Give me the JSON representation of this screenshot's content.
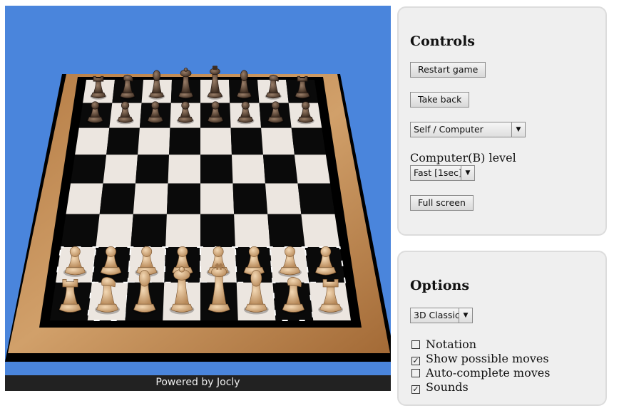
{
  "footer": {
    "text": "Powered by Jocly"
  },
  "board": {
    "colors": {
      "background": "#4a85dc",
      "frame": "#a8703d",
      "light": "#ece6e0",
      "dark": "#0a0a0a",
      "white_piece": "#d9b48a",
      "black_piece": "#5a4434"
    },
    "black_back": [
      "rook-icon",
      "knight-icon",
      "bishop-icon",
      "queen-icon",
      "king-icon",
      "bishop-icon",
      "knight-icon",
      "rook-icon"
    ],
    "white_back": [
      "rook-icon",
      "knight-icon",
      "bishop-icon",
      "queen-icon",
      "king-icon",
      "bishop-icon",
      "knight-icon",
      "rook-icon"
    ],
    "pawn": "pawn-icon"
  },
  "controls": {
    "title": "Controls",
    "restart": "Restart game",
    "takeback": "Take back",
    "mode": "Self / Computer",
    "level_label": "Computer(B) level",
    "level": "Fast [1sec]",
    "fullscreen": "Full screen"
  },
  "options": {
    "title": "Options",
    "skin": "3D Classic",
    "checks": [
      {
        "label": "Notation",
        "checked": false
      },
      {
        "label": "Show possible moves",
        "checked": true
      },
      {
        "label": "Auto-complete moves",
        "checked": false
      },
      {
        "label": "Sounds",
        "checked": true
      }
    ]
  }
}
